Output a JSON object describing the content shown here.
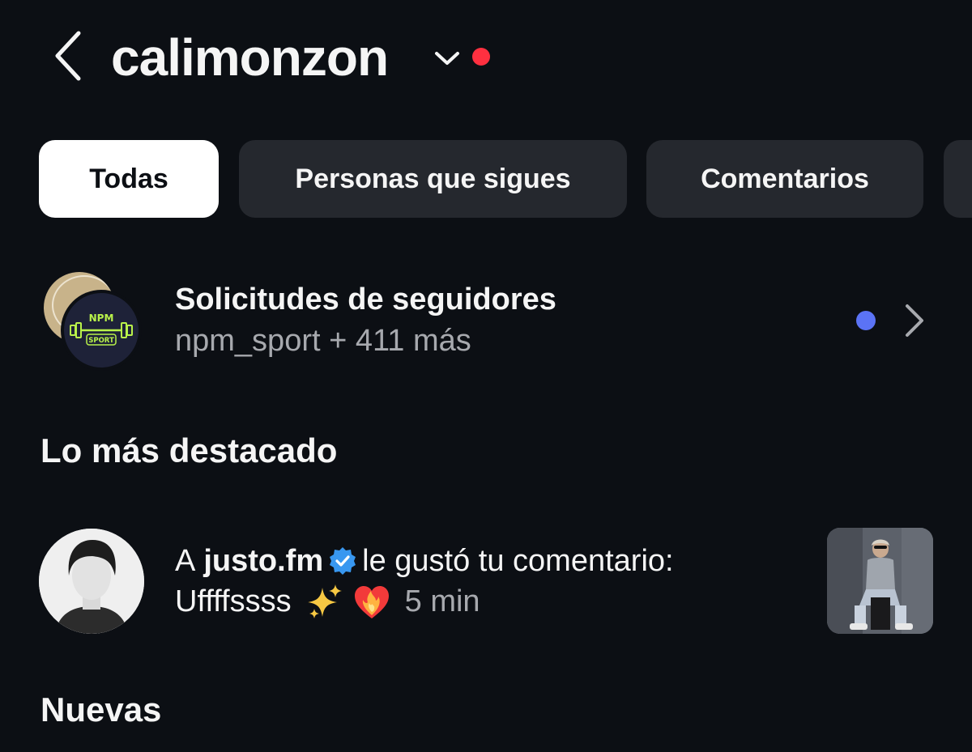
{
  "header": {
    "username": "calimonzon",
    "back_icon": "chevron-left-icon",
    "switch_icon": "chevron-down-icon",
    "alert_dot_color": "#ff3040"
  },
  "tabs": [
    {
      "label": "Todas",
      "active": true
    },
    {
      "label": "Personas que sigues",
      "active": false
    },
    {
      "label": "Comentarios",
      "active": false
    }
  ],
  "follow_requests": {
    "title": "Solicitudes de seguidores",
    "subtitle": "npm_sport + 411 más",
    "avatar_logo_top": "NPM",
    "avatar_logo_bottom": "SPORT",
    "unread_dot_color": "#5b73f5",
    "chevron_icon": "chevron-right-icon"
  },
  "sections": {
    "highlights": "Lo más destacado",
    "new": "Nuevas"
  },
  "notification": {
    "prefix": "A",
    "user": "justo.fm",
    "verified_color": "#3897f0",
    "action": "le gustó tu comentario:",
    "comment": "Uffffssss",
    "emojis": [
      "sparkles-emoji",
      "heart-on-fire-emoji"
    ],
    "time": "5 min"
  }
}
